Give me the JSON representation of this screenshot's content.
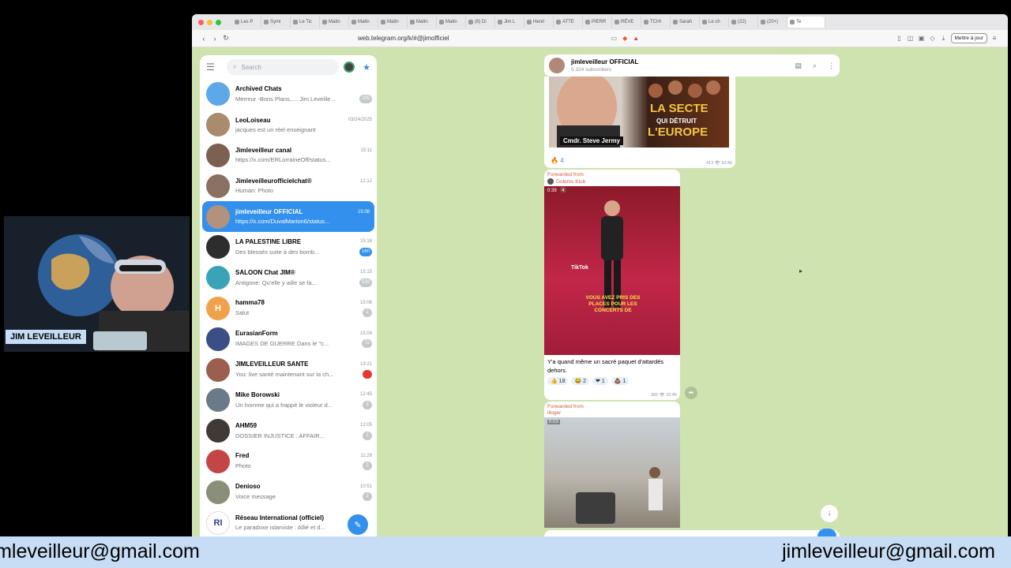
{
  "browser": {
    "tabs": [
      "Les P",
      "Symi",
      "Le Tic",
      "Maltn",
      "Maltn",
      "Maltn",
      "Maltn",
      "Maltn",
      "(8) Di",
      "Jim L",
      "Henri",
      "ATTE",
      "PIERR",
      "RÉVE",
      "TCHI",
      "Sarah",
      "Le ch",
      "(22)",
      "(20+)",
      "Te"
    ],
    "url": "web.telegram.org/k/#@jimofficiel",
    "update_button": "Mettre à jour"
  },
  "sidebar": {
    "search_placeholder": "Search",
    "chats": [
      {
        "name": "Archived Chats",
        "preview": "Merreur -Bons Plans,..., Jim Leveille...",
        "time": "",
        "badge": "295",
        "badge_style": "grey",
        "avatar_color": "#5fa8e8",
        "avatar_text": ""
      },
      {
        "name": "LeoLoiseau",
        "preview": "jacques est un réel enseignant",
        "time": "03/24/2025",
        "badge": "",
        "badge_style": "",
        "avatar_color": "#a98c6e",
        "avatar_text": ""
      },
      {
        "name": "Jimleveilleur canal",
        "preview": "https://x.com/ERLorraineOff/status...",
        "time": "15:11",
        "badge": "",
        "badge_style": "",
        "avatar_color": "#7c6152",
        "avatar_text": ""
      },
      {
        "name": "Jimleveilleurofficielchat®",
        "preview": "Human: Photo",
        "time": "12:12",
        "badge": "",
        "badge_style": "",
        "avatar_color": "#8a7163",
        "avatar_text": ""
      },
      {
        "name": "jimleveilleur OFFICIAL",
        "preview": "https://x.com/DuvalMarion6/status...",
        "time": "15:08",
        "badge": "",
        "badge_style": "",
        "avatar_color": "#b2927c",
        "avatar_text": "",
        "active": true
      },
      {
        "name": "LA PALESTINE LIBRE",
        "preview": "Des blessés suite à des bomb...",
        "time": "15:18",
        "badge": "160",
        "badge_style": "blue",
        "avatar_color": "#2d2d2d",
        "avatar_text": ""
      },
      {
        "name": "SALOON Chat JIM®",
        "preview": "Antigone: Qu'elle y aille se fa...",
        "time": "15:15",
        "badge": "539",
        "badge_style": "grey",
        "avatar_color": "#3aa3b8",
        "avatar_text": ""
      },
      {
        "name": "hamma78",
        "preview": "Salut",
        "time": "15:06",
        "badge": "1",
        "badge_style": "grey",
        "avatar_color": "#f0a24b",
        "avatar_text": "H"
      },
      {
        "name": "EurasianForm",
        "preview": "IMAGES DE GUERRE Dans le \"c...",
        "time": "15:04",
        "badge": "72",
        "badge_style": "grey",
        "avatar_color": "#3b4f86",
        "avatar_text": ""
      },
      {
        "name": "JIMLEVEILLEUR SANTE",
        "preview": "You: live santé maintenant sur la ch...",
        "time": "13:21",
        "badge": "",
        "badge_style": "red",
        "avatar_color": "#9b5e4f",
        "avatar_text": ""
      },
      {
        "name": "Mike Borowski",
        "preview": "Un homme qui a frappé le violeur d...",
        "time": "12:45",
        "badge": "3",
        "badge_style": "grey",
        "avatar_color": "#6b7a8a",
        "avatar_text": ""
      },
      {
        "name": "AHM59",
        "preview": "DOSSIER INJUSTICE : AFFAIR...",
        "time": "12:05",
        "badge": "2",
        "badge_style": "grey",
        "avatar_color": "#3f3a36",
        "avatar_text": ""
      },
      {
        "name": "Fred",
        "preview": "Photo",
        "time": "11:28",
        "badge": "2",
        "badge_style": "grey",
        "avatar_color": "#c44545",
        "avatar_text": ""
      },
      {
        "name": "Denioso",
        "preview": "Voice message",
        "time": "10:51",
        "badge": "2",
        "badge_style": "grey",
        "avatar_color": "#8a8f79",
        "avatar_text": ""
      },
      {
        "name": "Réseau International (officiel)",
        "preview": "Le paradoxe islamiste : Allié et d...",
        "time": "",
        "badge": "",
        "badge_style": "",
        "avatar_color": "#ffffff",
        "avatar_text": "RI"
      }
    ]
  },
  "chat": {
    "title": "jimleveilleur OFFICIAL",
    "subtitle": "5 324 subscribers",
    "msg1": {
      "image_text1": "LA SECTE",
      "image_text2": "QUI DÉTRUIT",
      "image_text3": "L'EUROPE",
      "image_badge": "Cmdr. Steve Jermy",
      "reaction": "4",
      "meta": "413 👁 10:45"
    },
    "msg2": {
      "forwarded": "Forwarded from",
      "source": "Golems Klub",
      "duration": "0:39",
      "video_text": "VOUS AVEZ PRIS DES PLACES POUR LES CONCERTS DE",
      "tiktok": "TikTok",
      "caption": "Y'a quand même un sacré paquet d'attardés dehors.",
      "reactions": [
        "18",
        "2",
        "1",
        "1"
      ],
      "meta": "365 👁 10:45"
    },
    "msg3": {
      "forwarded": "Forwarded from",
      "source": "illoger",
      "duration": "0:03"
    }
  },
  "overlay": {
    "name_label": "JIM LEVEILLEUR",
    "email_left": "jimleveilleur@gmail.com",
    "email_right": "jimleveilleur@gmail.com"
  }
}
